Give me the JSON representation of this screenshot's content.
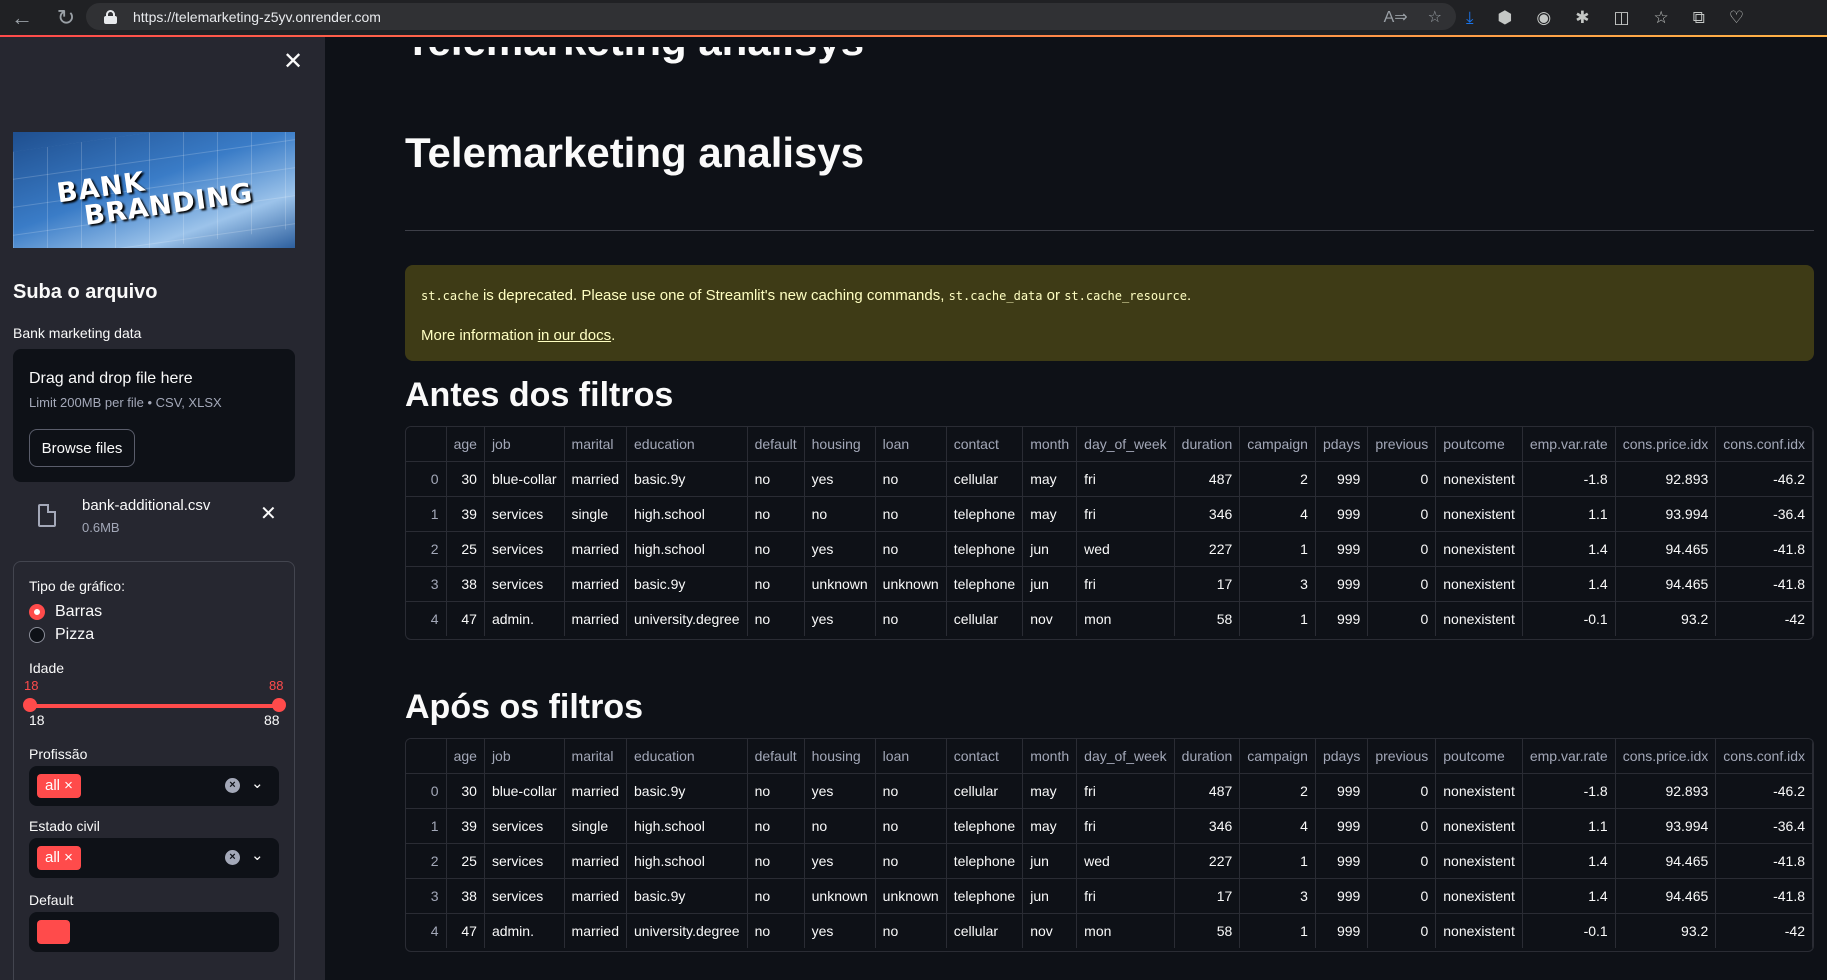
{
  "browser": {
    "url": "https://telemarketing-z5yv.onrender.com"
  },
  "sidebar": {
    "banner_line1": "BANK",
    "banner_line2": "BRANDING",
    "heading": "Suba o arquivo",
    "upload_label": "Bank marketing data",
    "dropzone_title": "Drag and drop file here",
    "dropzone_limit": "Limit 200MB per file • CSV, XLSX",
    "browse_label": "Browse files",
    "file_name": "bank-additional.csv",
    "file_size": "0.6MB",
    "chart_type_label": "Tipo de gráfico:",
    "chart_options": [
      "Barras",
      "Pizza"
    ],
    "age_label": "Idade",
    "age_min_selected": "18",
    "age_max_selected": "88",
    "age_min": "18",
    "age_max": "88",
    "job_label": "Profissão",
    "job_tag": "all",
    "marital_label": "Estado civil",
    "marital_tag": "all",
    "default_label": "Default"
  },
  "main": {
    "title": "Telemarketing analisys",
    "alert": {
      "code1": "st.cache",
      "text1": " is deprecated. Please use one of Streamlit's new caching commands, ",
      "code2": "st.cache_data",
      "text2": " or ",
      "code3": "st.cache_resource",
      "text3": ".",
      "more": "More information ",
      "link": "in our docs",
      "end": "."
    },
    "section_before": "Antes dos filtros",
    "section_after": "Após os filtros",
    "columns": [
      "",
      "age",
      "job",
      "marital",
      "education",
      "default",
      "housing",
      "loan",
      "contact",
      "month",
      "day_of_week",
      "duration",
      "campaign",
      "pdays",
      "previous",
      "poutcome",
      "emp.var.rate",
      "cons.price.idx",
      "cons.conf.idx"
    ],
    "rows": [
      [
        "0",
        "30",
        "blue-collar",
        "married",
        "basic.9y",
        "no",
        "yes",
        "no",
        "cellular",
        "may",
        "fri",
        "487",
        "2",
        "999",
        "0",
        "nonexistent",
        "-1.8",
        "92.893",
        "-46.2"
      ],
      [
        "1",
        "39",
        "services",
        "single",
        "high.school",
        "no",
        "no",
        "no",
        "telephone",
        "may",
        "fri",
        "346",
        "4",
        "999",
        "0",
        "nonexistent",
        "1.1",
        "93.994",
        "-36.4"
      ],
      [
        "2",
        "25",
        "services",
        "married",
        "high.school",
        "no",
        "yes",
        "no",
        "telephone",
        "jun",
        "wed",
        "227",
        "1",
        "999",
        "0",
        "nonexistent",
        "1.4",
        "94.465",
        "-41.8"
      ],
      [
        "3",
        "38",
        "services",
        "married",
        "basic.9y",
        "no",
        "unknown",
        "unknown",
        "telephone",
        "jun",
        "fri",
        "17",
        "3",
        "999",
        "0",
        "nonexistent",
        "1.4",
        "94.465",
        "-41.8"
      ],
      [
        "4",
        "47",
        "admin.",
        "married",
        "university.degree",
        "no",
        "yes",
        "no",
        "cellular",
        "nov",
        "mon",
        "58",
        "1",
        "999",
        "0",
        "nonexistent",
        "-0.1",
        "93.2",
        "-42"
      ]
    ]
  }
}
